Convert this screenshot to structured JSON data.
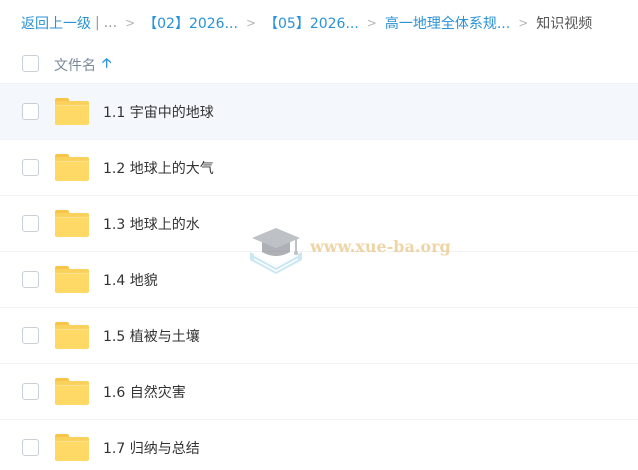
{
  "breadcrumb": {
    "back": "返回上一级",
    "divider": "|",
    "ellipsis": "...",
    "separator": ">",
    "items": [
      "【02】2026...",
      "【05】2026...",
      "高一地理全体系规..."
    ],
    "current": "知识视频"
  },
  "list_header": {
    "column_name": "文件名",
    "sort_icon": "arrow-up-icon"
  },
  "files": [
    {
      "name": "1.1 宇宙中的地球",
      "icon": "folder-icon"
    },
    {
      "name": "1.2 地球上的大气",
      "icon": "folder-icon"
    },
    {
      "name": "1.3 地球上的水",
      "icon": "folder-icon"
    },
    {
      "name": "1.4 地貌",
      "icon": "folder-icon"
    },
    {
      "name": "1.5 植被与土壤",
      "icon": "folder-icon"
    },
    {
      "name": "1.6 自然灾害",
      "icon": "folder-icon"
    },
    {
      "name": "1.7 归纳与总结",
      "icon": "folder-icon"
    }
  ],
  "watermark": {
    "text": "www.xue-ba.org"
  },
  "colors": {
    "link": "#2a92d8",
    "folder": "#fbd15b",
    "hover_row": "#f4f8fd"
  }
}
